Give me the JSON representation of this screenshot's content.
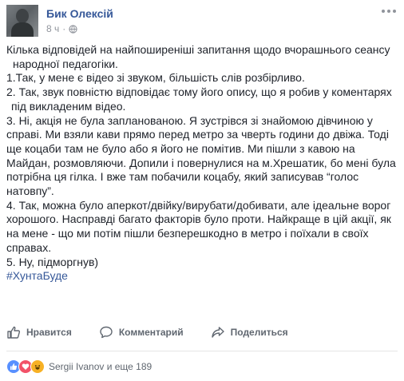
{
  "post": {
    "author": "Бик Олексій",
    "time": "8 ч",
    "separator": "·",
    "body_lines": [
      "Кілька відповідей на найпоширеніші запитання щодо вчорашнього сеансу",
      "народної педагогіки.",
      "1.Так, у мене є відео зі звуком, більшість слів розбірливо.",
      "2. Так, звук повністю відповідає тому його опису, що я робив у коментарях",
      "під викладеним відео.",
      "3. Ні, акція не була запланованою. Я зустрівся зі знайомою дівчиною у",
      "справі. Ми взяли кави прямо перед метро за чверть години до двіжа. Тоді",
      "ще коцаби там не було або я його не помітив. Ми пішли з кавою на",
      "Майдан, розмовляючи. Допили і повернулися на м.Хрешатик, бо мені була",
      "потрібна ця гілка. І вже там побачили коцабу, який записував “голос",
      "натовпу”.",
      "4. Так, можна було аперкот/двійку/вирубати/добивати, але ідеальне ворог",
      "хорошого. Насправді багато факторів було проти. Найкраще в цій акції, як",
      "на мене - що ми потім пішли безперешкодно в метро і поїхали в своїх",
      "справах.",
      "5. Ну, підморгнув)"
    ],
    "hashtag": "#ХунтаБуде"
  },
  "actions": {
    "like_label": "Нравится",
    "comment_label": "Комментарий",
    "share_label": "Поделиться"
  },
  "reactions": {
    "types": [
      "like",
      "love",
      "haha"
    ],
    "summary": "Sergii Ivanov и еще 189"
  },
  "icons": {
    "globe": "globe-icon",
    "more": "more-options-icon",
    "like": "thumbs-up-icon",
    "comment": "speech-bubble-icon",
    "share": "share-arrow-icon"
  },
  "colors": {
    "link": "#365899",
    "text": "#1d2129",
    "muted": "#90949c",
    "action": "#606770",
    "like": "#5890ff",
    "love": "#f25268",
    "haha": "#f7b125"
  }
}
